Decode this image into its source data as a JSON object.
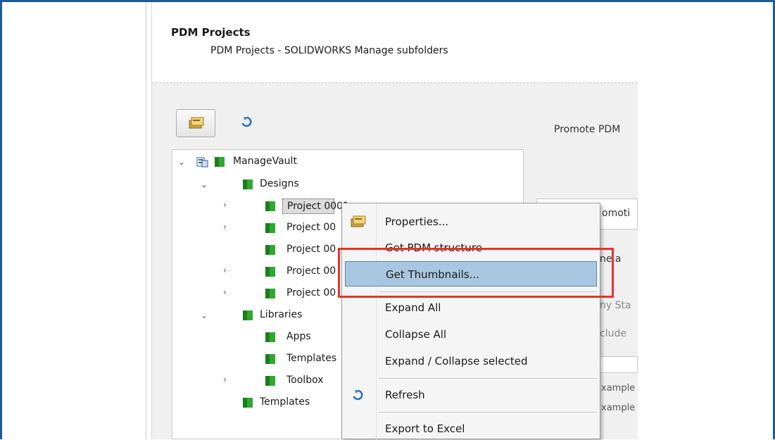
{
  "header": {
    "title": "PDM Projects",
    "subtitle": "PDM Projects - SOLIDWORKS Manage subfolders"
  },
  "toolbar": {
    "properties_icon": "properties-icon",
    "refresh_icon": "refresh-icon"
  },
  "right_panel": {
    "promote_label": "Promote PDM",
    "box_text": "omoti",
    "name_text": "ne a",
    "any_state": "ny Sta",
    "include": "clude",
    "example1": "xample",
    "example2": "xample"
  },
  "tree": {
    "root": "ManageVault",
    "designs": "Designs",
    "projects": [
      "Project 0001",
      "Project 00",
      "Project 00",
      "Project 00",
      "Project 00"
    ],
    "libraries": "Libraries",
    "lib_items": [
      "Apps",
      "Templates",
      "Toolbox"
    ],
    "templates": "Templates"
  },
  "context_menu": {
    "items": [
      {
        "label": "Properties..."
      },
      {
        "label": "Get PDM structure"
      },
      {
        "label": "Get Thumbnails..."
      },
      {
        "label": "Expand All"
      },
      {
        "label": "Collapse All"
      },
      {
        "label": "Expand / Collapse selected"
      },
      {
        "label": "Refresh"
      },
      {
        "label": "Export to Excel"
      }
    ]
  },
  "colors": {
    "frame": "#1f5a96",
    "highlight": "#a8c6e0",
    "callout": "#e8312b",
    "folder": "#2fa82f"
  }
}
